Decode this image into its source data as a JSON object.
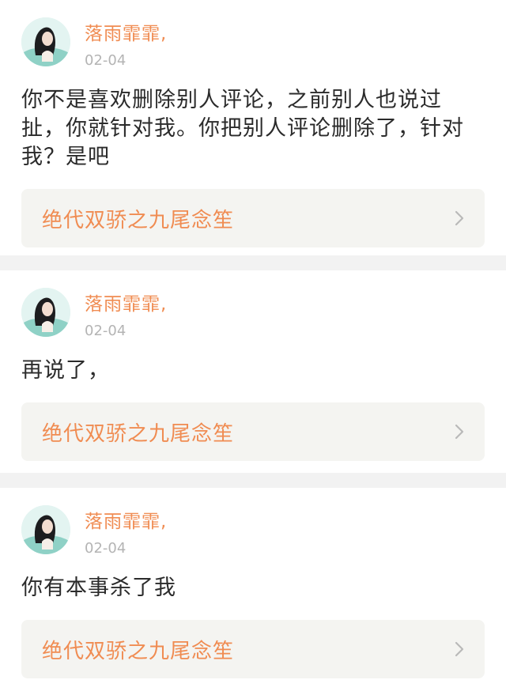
{
  "comments": [
    {
      "author": "落雨霏霏,",
      "date": "02-04",
      "text": "你不是喜欢删除别人评论，之前别人也说过扯，你就针对我。你把别人评论删除了，针对我？是吧",
      "link_label": "绝代双骄之九尾念笙"
    },
    {
      "author": "落雨霏霏,",
      "date": "02-04",
      "text": "再说了，",
      "link_label": "绝代双骄之九尾念笙"
    },
    {
      "author": "落雨霏霏,",
      "date": "02-04",
      "text": "你有本事杀了我",
      "link_label": "绝代双骄之九尾念笙"
    }
  ],
  "icons": {
    "avatar": "avatar",
    "chevron": "chevron-right-icon"
  },
  "colors": {
    "accent": "#f08c52",
    "date": "#b4b4b4",
    "text": "#2b2b2b",
    "link_bg": "#f4f4f1",
    "page_bg": "#f2f2f2"
  }
}
